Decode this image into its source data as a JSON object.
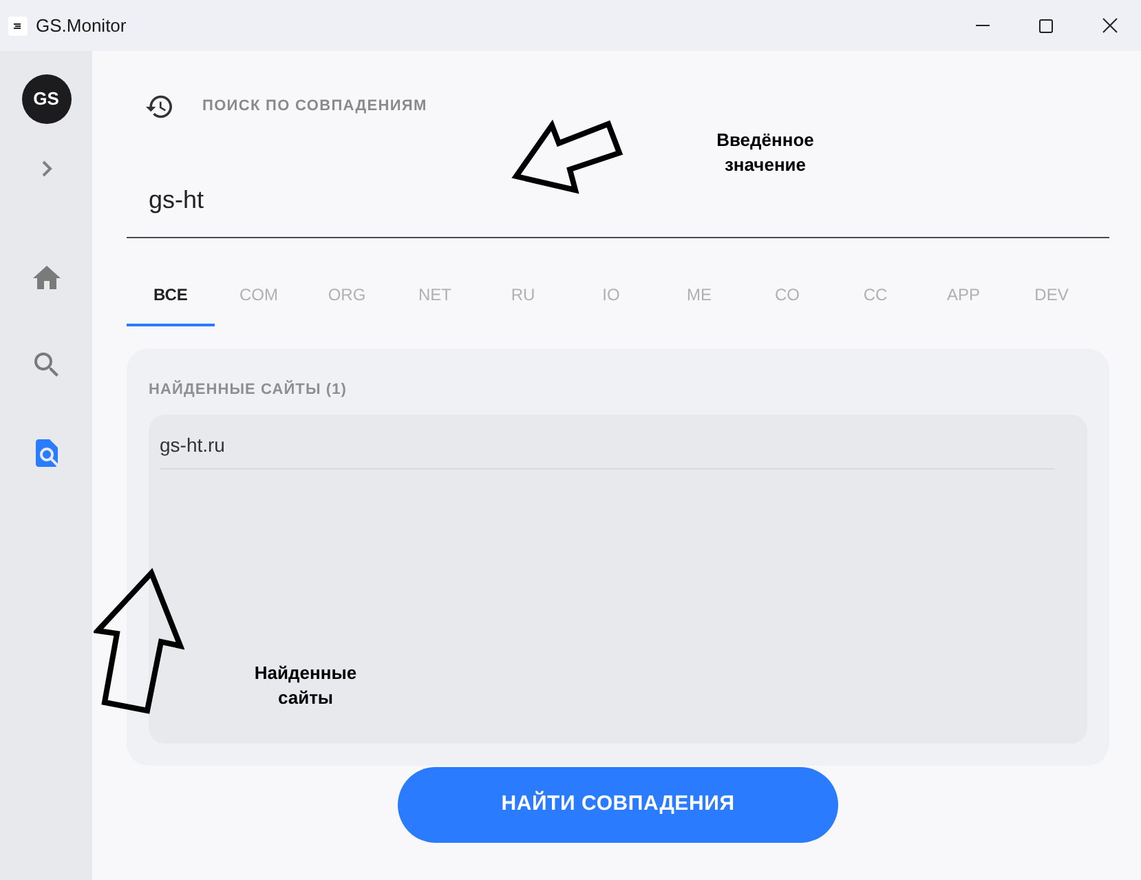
{
  "window": {
    "title": "GS.Monitor"
  },
  "sidebar": {
    "avatar": "GS",
    "items": [
      {
        "kind": "home",
        "selected": false
      },
      {
        "kind": "search",
        "selected": false
      },
      {
        "kind": "page-search",
        "selected": true
      }
    ]
  },
  "search": {
    "label": "ПОИСК ПО СОВПАДЕНИЯМ",
    "value": "gs-ht"
  },
  "tabs": [
    {
      "label": "ВСЕ",
      "selected": true
    },
    {
      "label": "COM",
      "selected": false
    },
    {
      "label": "ORG",
      "selected": false
    },
    {
      "label": "NET",
      "selected": false
    },
    {
      "label": "RU",
      "selected": false
    },
    {
      "label": "IO",
      "selected": false
    },
    {
      "label": "ME",
      "selected": false
    },
    {
      "label": "CO",
      "selected": false
    },
    {
      "label": "CC",
      "selected": false
    },
    {
      "label": "APP",
      "selected": false
    },
    {
      "label": "DEV",
      "selected": false
    }
  ],
  "results": {
    "title": "НАЙДЕННЫЕ САЙТЫ (1)",
    "items": [
      "gs-ht.ru"
    ]
  },
  "button": "НАЙТИ СОВПАДЕНИЯ",
  "annotations": [
    {
      "kind": "input-note",
      "text": "Введённое значение"
    },
    {
      "kind": "results-note",
      "text": "Найденные сайты"
    }
  ]
}
